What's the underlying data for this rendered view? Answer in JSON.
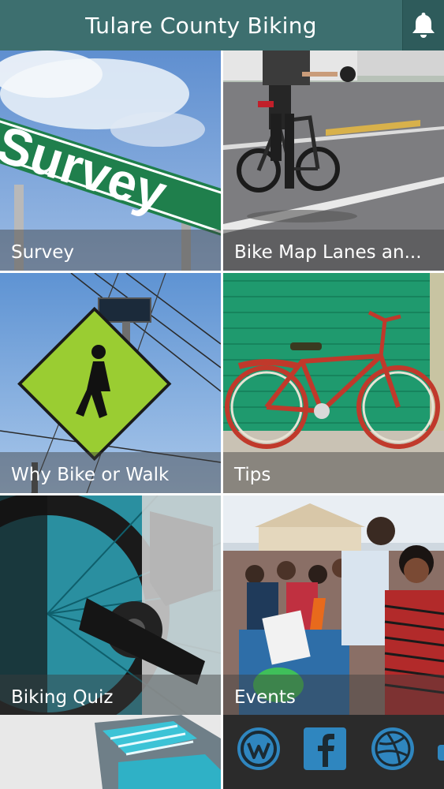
{
  "header": {
    "title": "Tulare County Biking",
    "notification_icon": "bell-icon"
  },
  "tiles": [
    {
      "label": "Survey",
      "image": "survey-street-sign"
    },
    {
      "label": "Bike Map Lanes an...",
      "image": "cyclist-on-road"
    },
    {
      "label": "Why Bike or Walk",
      "image": "pedestrian-crossing-sign"
    },
    {
      "label": "Tips",
      "image": "red-cruiser-bicycle"
    },
    {
      "label": "Biking Quiz",
      "image": "bike-derailleur-closeup"
    },
    {
      "label": "Events",
      "image": "community-event-crowd"
    },
    {
      "label": "",
      "image": "sneakers-closeup"
    }
  ],
  "sign_text": "Survey",
  "social": {
    "icons": [
      "wordpress-icon",
      "facebook-icon",
      "dribbble-icon"
    ]
  },
  "colors": {
    "header_bg": "#3d6f6f",
    "bell_bg": "#2e5b5b",
    "caption_overlay": "rgba(60,60,60,0.45)",
    "social_bg": "#2b2b2b",
    "social_icon": "#2f86bf"
  }
}
